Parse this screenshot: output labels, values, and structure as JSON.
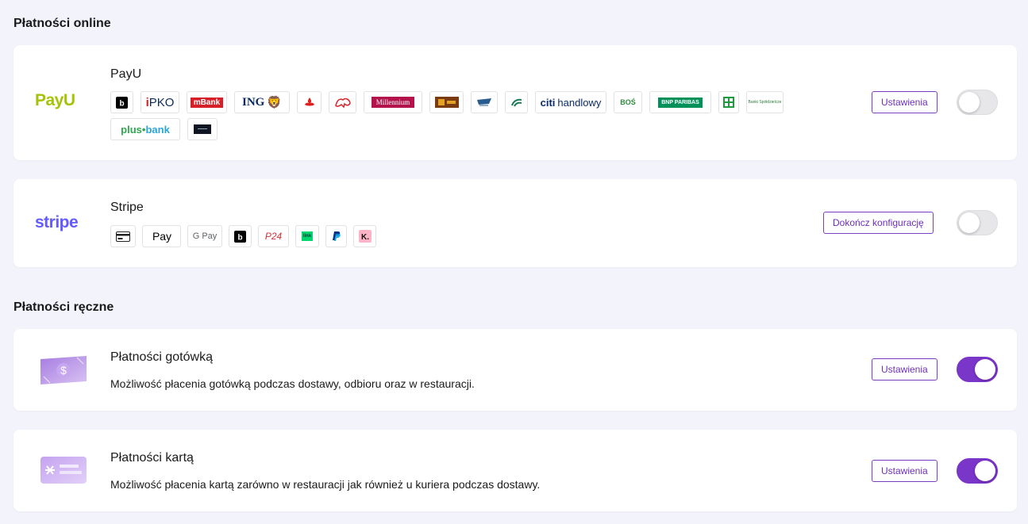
{
  "sections": {
    "online_title": "Płatności online",
    "manual_title": "Płatności ręczne"
  },
  "payu": {
    "logo_text": "PayU",
    "name": "PayU",
    "settings_label": "Ustawienia",
    "enabled": false,
    "banks": {
      "pko": "PKO",
      "mbank": "mBank",
      "ing": "ING",
      "millennium": "Millennium",
      "citi": "handlowy",
      "bos": "BOŚ",
      "bnp": "BNP PARIBAS",
      "spoldzielcze": "Banki Spółdzielcze",
      "plus_a": "plus",
      "plus_b": "bank"
    }
  },
  "stripe": {
    "logo_text": "stripe",
    "name": "Stripe",
    "config_label": "Dokończ konfigurację",
    "enabled": false,
    "methods": {
      "applepay": "Pay",
      "googlepay": "G Pay",
      "p24": "P24",
      "link": "link"
    }
  },
  "cash": {
    "name": "Płatności gotówką",
    "description": "Możliwość płacenia gotówką podczas dostawy, odbioru oraz w restauracji.",
    "settings_label": "Ustawienia",
    "enabled": true,
    "icon": "cash-banknote-icon"
  },
  "card": {
    "name": "Płatności kartą",
    "description": "Możliwość płacenia kartą zarówno w restauracji jak również u kuriera podczas dostawy.",
    "settings_label": "Ustawienia",
    "enabled": true,
    "icon": "credit-card-icon"
  },
  "colors": {
    "accent": "#7a35c9",
    "payu_green": "#a6c307",
    "stripe_blue": "#635bff"
  }
}
